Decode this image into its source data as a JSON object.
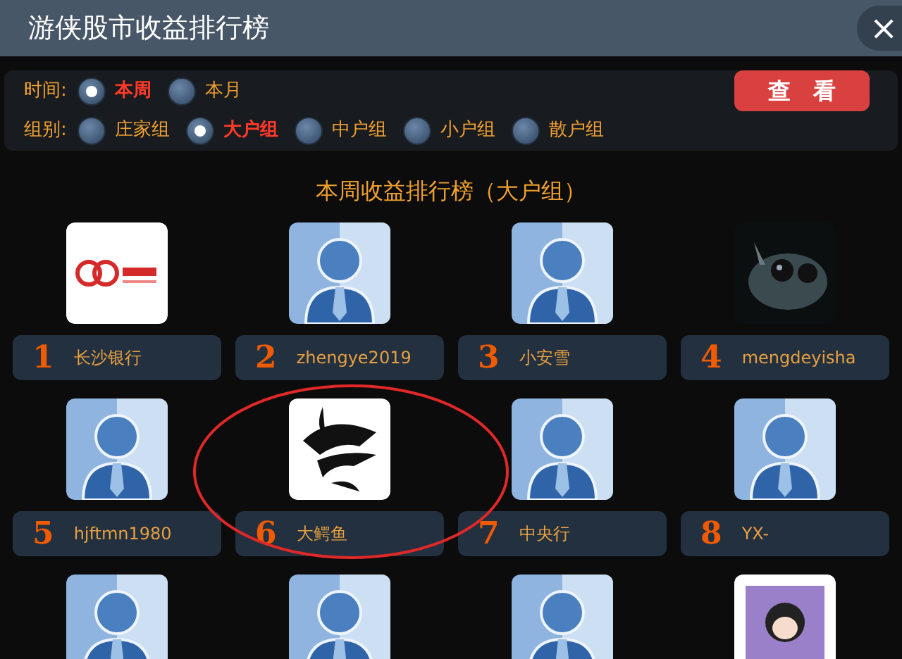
{
  "window": {
    "title": "游侠股市收益排行榜",
    "close": "×"
  },
  "filters": [
    {
      "label": "时间:",
      "options": [
        {
          "label": "本周",
          "selected": true
        },
        {
          "label": "本月",
          "selected": false
        }
      ]
    },
    {
      "label": "组别:",
      "options": [
        {
          "label": "庄家组",
          "selected": false
        },
        {
          "label": "大户组",
          "selected": true
        },
        {
          "label": "中户组",
          "selected": false
        },
        {
          "label": "小户组",
          "selected": false
        },
        {
          "label": "散户组",
          "selected": false
        }
      ]
    }
  ],
  "view_button": "查　看",
  "heading": "本周收益排行榜（大户组）",
  "ranking": [
    {
      "rank": "1",
      "name": "长沙银行",
      "kind": "logo",
      "circled": false
    },
    {
      "rank": "2",
      "name": "zhengye2019",
      "kind": "default",
      "circled": false
    },
    {
      "rank": "3",
      "name": "小安雪",
      "kind": "default",
      "circled": false
    },
    {
      "rank": "4",
      "name": "mengdeyisha",
      "kind": "fish",
      "circled": false
    },
    {
      "rank": "5",
      "name": "hjftmn1980",
      "kind": "default",
      "circled": false
    },
    {
      "rank": "6",
      "name": "大鳄鱼",
      "kind": "crocodile",
      "circled": true
    },
    {
      "rank": "7",
      "name": "中央行",
      "kind": "default",
      "circled": false
    },
    {
      "rank": "8",
      "name": "YX-",
      "kind": "default",
      "circled": false
    }
  ],
  "partial_row": [
    {
      "kind": "default"
    },
    {
      "kind": "default"
    },
    {
      "kind": "default"
    },
    {
      "kind": "cartoon"
    }
  ]
}
